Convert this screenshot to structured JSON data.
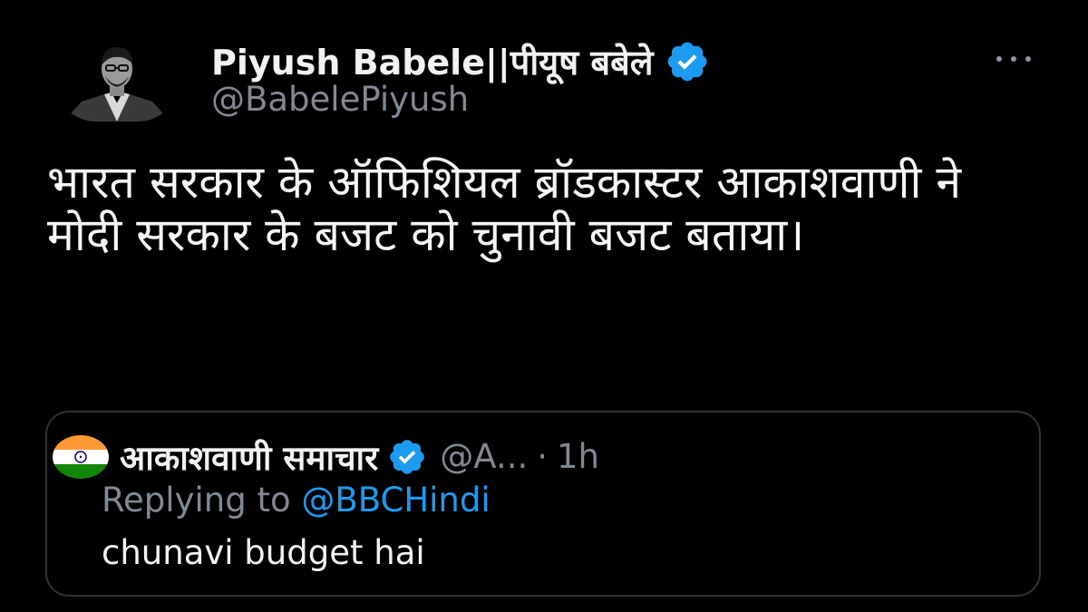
{
  "author": {
    "display_name": "Piyush Babele||पीयूष बबेले",
    "handle": "@BabelePiyush",
    "verified": true,
    "avatar_icon": "profile-photo"
  },
  "tweet": {
    "text": "भारत सरकार के ऑफिशियल ब्रॉडकास्टर आकाशवाणी ने मोदी सरकार के बजट को चुनावी बजट बताया।"
  },
  "menu": {
    "icon": "more-horizontal-icon"
  },
  "quoted_tweet": {
    "display_name": "आकाशवाणी समाचार",
    "handle": "@A...",
    "separator": "·",
    "time": "1h",
    "verified": true,
    "avatar_icon": "india-flag-icon",
    "replying_prefix": "Replying to",
    "replying_to": "@BBCHindi",
    "text": "chunavi budget hai"
  },
  "colors": {
    "background": "#000000",
    "text": "#e7e9ea",
    "secondary": "#7f8a95",
    "accent": "#1d9bf0",
    "border": "#2f3336"
  }
}
